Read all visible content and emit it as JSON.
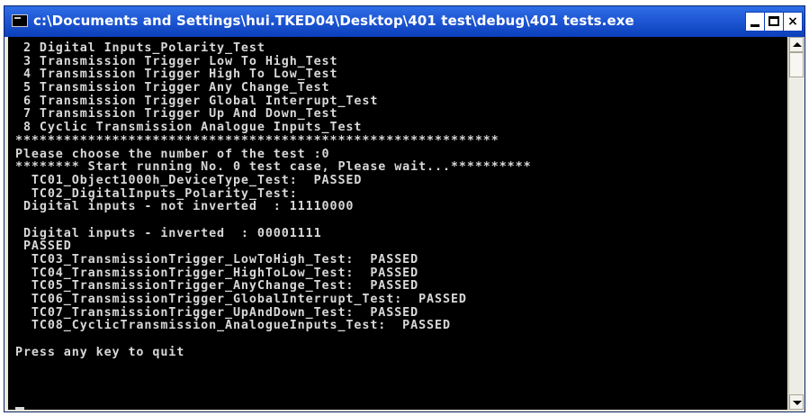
{
  "window": {
    "title": "c:\\Documents and Settings\\hui.TKED04\\Desktop\\401 test\\debug\\401 tests.exe",
    "icon": "console-icon"
  },
  "controls": {
    "minimize": "minimize-icon",
    "maximize": "maximize-icon",
    "close_label": "×"
  },
  "console": {
    "lines": [
      " 2 Digital Inputs_Polarity_Test",
      " 3 Transmission Trigger Low To High_Test",
      " 4 Transmission Trigger High To Low_Test",
      " 5 Transmission Trigger Any Change_Test",
      " 6 Transmission Trigger Global Interrupt_Test",
      " 7 Transmission Trigger Up And Down_Test",
      " 8 Cyclic Transmission Analogue Inputs_Test",
      "************************************************************",
      "Please choose the number of the test :0",
      "******** Start running No. 0 test case, Please wait...**********",
      "  TC01_Object1000h_DeviceType_Test:  PASSED",
      "  TC02_DigitalInputs_Polarity_Test:",
      " Digital inputs - not inverted  : 11110000",
      "",
      " Digital inputs - inverted  : 00001111",
      " PASSED",
      "  TC03_TransmissionTrigger_LowToHigh_Test:  PASSED",
      "  TC04_TransmissionTrigger_HighToLow_Test:  PASSED",
      "  TC05_TransmissionTrigger_AnyChange_Test:  PASSED",
      "  TC06_TransmissionTrigger_GlobalInterrupt_Test:  PASSED",
      "  TC07_TransmissionTrigger_UpAndDown_Test:  PASSED",
      "  TC08_CyclicTransmission_AnalogueInputs_Test:  PASSED",
      "",
      "Press any key to quit"
    ]
  },
  "scrollbar": {
    "up": "scroll-up-arrow-icon",
    "down": "scroll-down-arrow-icon"
  }
}
